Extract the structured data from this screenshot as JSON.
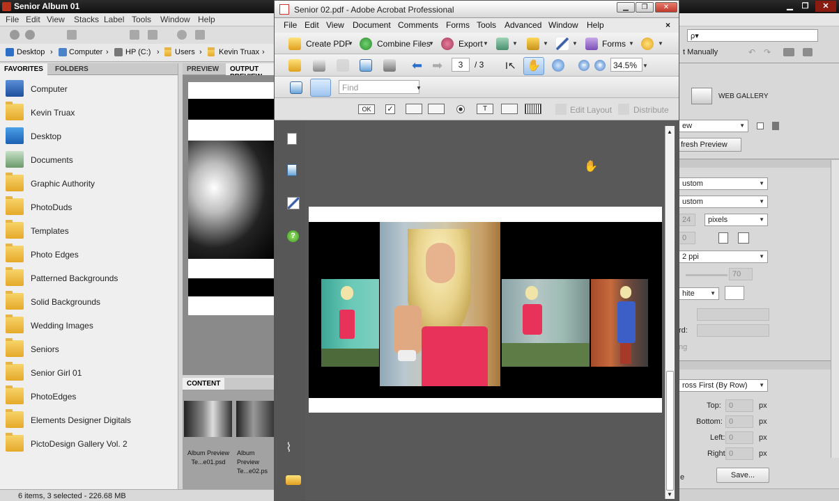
{
  "bridge": {
    "title": "Senior Album 01",
    "menu": [
      "File",
      "Edit",
      "View",
      "Stacks",
      "Label",
      "Tools",
      "Window",
      "Help"
    ],
    "path": [
      "Desktop",
      "Computer",
      "HP (C:)",
      "Users",
      "Kevin Truax"
    ],
    "tabs": {
      "favorites": "FAVORITES",
      "folders": "FOLDERS",
      "preview": "PREVIEW",
      "output": "OUTPUT PREVIEW",
      "content": "CONTENT"
    },
    "favorites": [
      "Computer",
      "Kevin Truax",
      "Desktop",
      "Documents",
      "Graphic Authority",
      "PhotoDuds",
      "Templates",
      "Photo Edges",
      "Patterned Backgrounds",
      "Solid Backgrounds",
      "Wedding Images",
      "Seniors",
      "Senior Girl 01",
      "PhotoEdges",
      "Elements Designer Digitals",
      "PictoDesign Gallery Vol. 2"
    ],
    "status": "6 items, 3 selected - 226.68 MB",
    "thumbs": [
      {
        "label": "Album Preview Te...e01.psd"
      },
      {
        "label": "Album Preview Te...e02.ps"
      }
    ],
    "sort": "t Manually",
    "search_placeholder": "ρ▾",
    "right": {
      "web_gallery": "WEB GALLERY",
      "view": "ew",
      "refresh": "fresh Preview",
      "custom1": "ustom",
      "custom2": "ustom",
      "pixels": "pixels",
      "v24": "24",
      "v0": "0",
      "ppi": "2 ppi",
      "quality": "70",
      "white": "hite",
      "rd": "rd:",
      "ng": "ng",
      "across": "ross First (By Row)",
      "top": "Top:",
      "bottom": "Bottom:",
      "left": "Left:",
      "right": "Right:",
      "px": "px",
      "mv": "0",
      "e": "e",
      "save": "Save..."
    }
  },
  "acrobat": {
    "title": "Senior 02.pdf - Adobe Acrobat Professional",
    "menu": [
      "File",
      "Edit",
      "View",
      "Document",
      "Comments",
      "Forms",
      "Tools",
      "Advanced",
      "Window",
      "Help"
    ],
    "close": "×",
    "toolbar1": {
      "create": "Create PDF",
      "combine": "Combine Files",
      "export": "Export",
      "forms": "Forms"
    },
    "toolbar2": {
      "page": "3",
      "total": "/ 3",
      "zoom": "34.5%"
    },
    "find_placeholder": "Find",
    "forms_tb": {
      "ok": "OK",
      "edit_layout": "Edit Layout",
      "distribute": "Distribute"
    }
  },
  "colors": {
    "accent_red": "#b8321c",
    "dress_pink": "#e8325a",
    "dress_blue": "#3c5fc7"
  }
}
